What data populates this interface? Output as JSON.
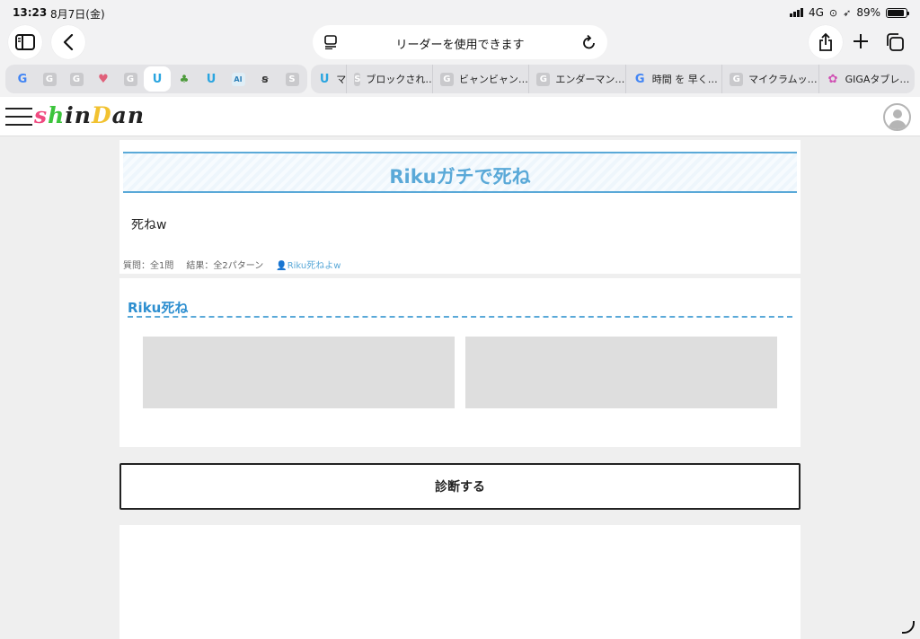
{
  "status": {
    "time": "13:23",
    "date": "8月7日(金)",
    "network": "4G",
    "battery": "89%",
    "battery_level": 0.89
  },
  "toolbar": {
    "address_text": "リーダーを使用できます",
    "icons": [
      "sidebar-icon",
      "back-icon",
      "reader-icon",
      "reload-icon",
      "share-icon",
      "plus-icon",
      "tabs-icon"
    ]
  },
  "tabbar": {
    "pinned": [
      {
        "icon": "google-icon",
        "glyph": "G"
      },
      {
        "icon": "gray-g-icon",
        "glyph": "G"
      },
      {
        "icon": "gray-g-icon",
        "glyph": "G"
      },
      {
        "icon": "heart-icon",
        "glyph": "♥"
      },
      {
        "icon": "gray-g-icon",
        "glyph": "G"
      },
      {
        "icon": "shindan-icon",
        "glyph": "U"
      },
      {
        "icon": "plant-icon",
        "glyph": "♣"
      },
      {
        "icon": "shindan-icon",
        "glyph": "U"
      },
      {
        "icon": "ai-icon",
        "glyph": "AI"
      },
      {
        "icon": "s-logo-icon",
        "glyph": "ꞩ"
      },
      {
        "icon": "gray-s-icon",
        "glyph": "S"
      }
    ],
    "tabs": [
      {
        "label": "マ",
        "icon": "shindan-icon",
        "glyph": "U"
      },
      {
        "label": "ブロックされ…",
        "icon": "gray-s-icon",
        "glyph": "S"
      },
      {
        "label": "ビャンビャン…",
        "icon": "gray-g-icon",
        "glyph": "G"
      },
      {
        "label": "エンダーマン…",
        "icon": "gray-g-icon",
        "glyph": "G"
      },
      {
        "label": "時間 を 早く…",
        "icon": "google-icon",
        "glyph": "G"
      },
      {
        "label": "マイクラムッ…",
        "icon": "gray-g-icon",
        "glyph": "G"
      },
      {
        "label": "GIGAタブレ…",
        "icon": "flower-icon",
        "glyph": "✿"
      }
    ]
  },
  "site": {
    "logo_letters": [
      {
        "ch": "s",
        "color": "#f04a80"
      },
      {
        "ch": "h",
        "color": "#3cc43c"
      },
      {
        "ch": "i",
        "color": "#222222"
      },
      {
        "ch": "n",
        "color": "#222222"
      },
      {
        "ch": "D",
        "color": "#f2c230"
      },
      {
        "ch": "a",
        "color": "#222222"
      },
      {
        "ch": "n",
        "color": "#222222"
      }
    ],
    "accent": "#5aa9d8"
  },
  "diagnosis": {
    "title": "Rikuガチで死ね",
    "description": "死ねw",
    "questions": "質問：全1問",
    "results": "結果：全2パターン",
    "author": "Riku死ねよw"
  },
  "result_section": {
    "title": "Riku死ね"
  },
  "button": {
    "label": "診断する"
  }
}
